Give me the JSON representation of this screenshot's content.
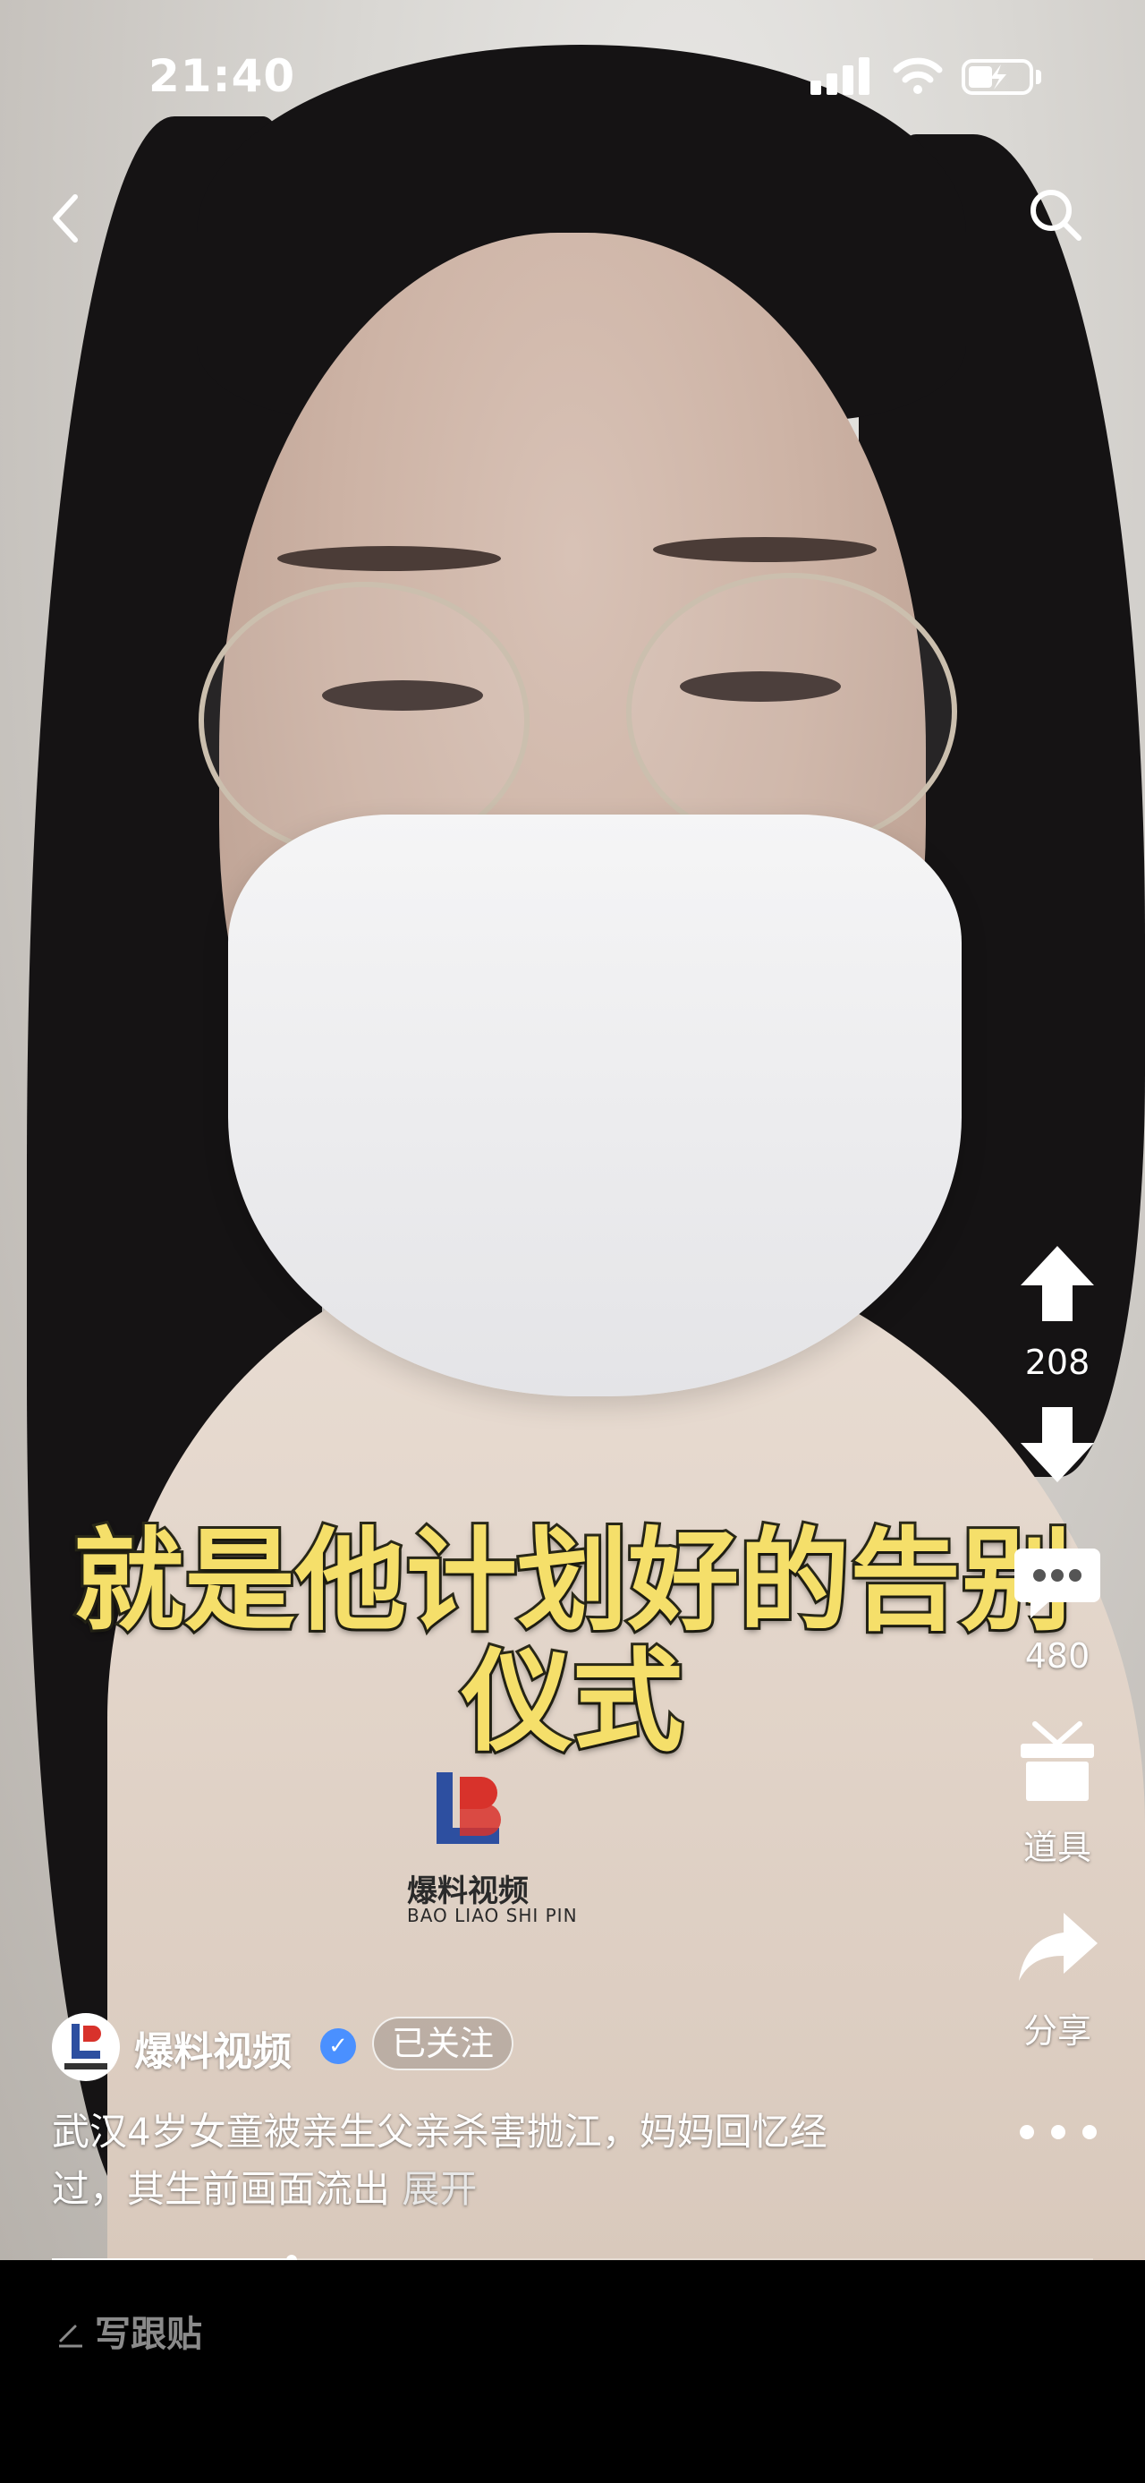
{
  "status_bar": {
    "time": "21:40"
  },
  "nav": {
    "back_icon": "chevron-left-icon",
    "search_icon": "search-icon"
  },
  "caption": {
    "line1": "就是他计划好的告别",
    "line2": "仪式"
  },
  "watermark": {
    "name": "爆料视频",
    "sub": "BAO LIAO SHI PIN"
  },
  "rail": {
    "upvote_count": "208",
    "comment_count": "480",
    "props_label": "道具",
    "share_label": "分享"
  },
  "author": {
    "name": "爆料视频",
    "follow_label": "已关注"
  },
  "description": {
    "text": "武汉4岁女童被亲生父亲杀害抛江，妈妈回忆经过，其生前画面流出",
    "more_label": "展开"
  },
  "progress": 0.23,
  "bottom": {
    "write_post_label": "写跟贴"
  }
}
